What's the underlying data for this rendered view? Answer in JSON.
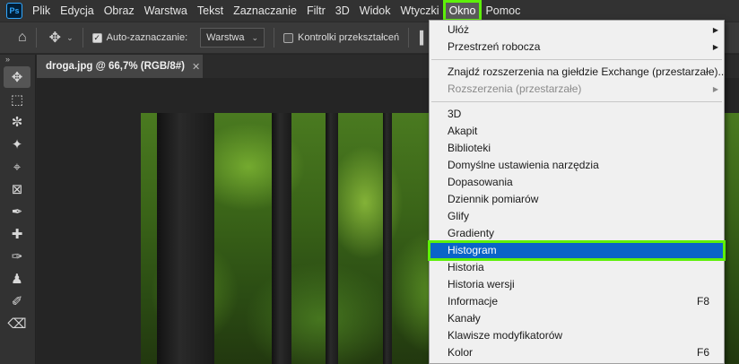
{
  "app": {
    "logo_text": "Ps"
  },
  "menubar": {
    "items": [
      "Plik",
      "Edycja",
      "Obraz",
      "Warstwa",
      "Tekst",
      "Zaznaczanie",
      "Filtr",
      "3D",
      "Widok",
      "Wtyczki",
      "Okno",
      "Pomoc"
    ],
    "active": "Okno"
  },
  "options": {
    "auto_select_label": "Auto-zaznaczanie:",
    "auto_select_checked": true,
    "layer_dropdown": "Warstwa",
    "transform_controls_label": "Kontrolki przekształceń",
    "transform_controls_checked": false
  },
  "toolbar": {
    "tools": [
      "move-tool-icon",
      "marquee-tool-icon",
      "lasso-tool-icon",
      "magic-wand-tool-icon",
      "crop-tool-icon",
      "frame-tool-icon",
      "eyedropper-tool-icon",
      "healing-brush-tool-icon",
      "brush-tool-icon",
      "clone-stamp-tool-icon",
      "history-brush-tool-icon",
      "eraser-tool-icon"
    ]
  },
  "document": {
    "tab_title": "droga.jpg @ 66,7% (RGB/8#)"
  },
  "window_menu": {
    "group1": [
      {
        "label": "Ułóż",
        "submenu": true
      },
      {
        "label": "Przestrzeń robocza",
        "submenu": true
      }
    ],
    "group2": [
      {
        "label": "Znajdź rozszerzenia na giełdzie Exchange (przestarzałe)..."
      },
      {
        "label": "Rozszerzenia (przestarzałe)",
        "submenu": true,
        "disabled": true
      }
    ],
    "group3": [
      {
        "label": "3D"
      },
      {
        "label": "Akapit"
      },
      {
        "label": "Biblioteki"
      },
      {
        "label": "Domyślne ustawienia narzędzia"
      },
      {
        "label": "Dopasowania"
      },
      {
        "label": "Dziennik pomiarów"
      },
      {
        "label": "Glify"
      },
      {
        "label": "Gradienty"
      },
      {
        "label": "Histogram",
        "highlight": true
      },
      {
        "label": "Historia"
      },
      {
        "label": "Historia wersji"
      },
      {
        "label": "Informacje",
        "shortcut": "F8"
      },
      {
        "label": "Kanały"
      },
      {
        "label": "Klawisze modyfikatorów"
      },
      {
        "label": "Kolor",
        "shortcut": "F6"
      }
    ]
  },
  "colors": {
    "highlight": "#0a64c8",
    "focus_outline": "#5ef00a"
  }
}
